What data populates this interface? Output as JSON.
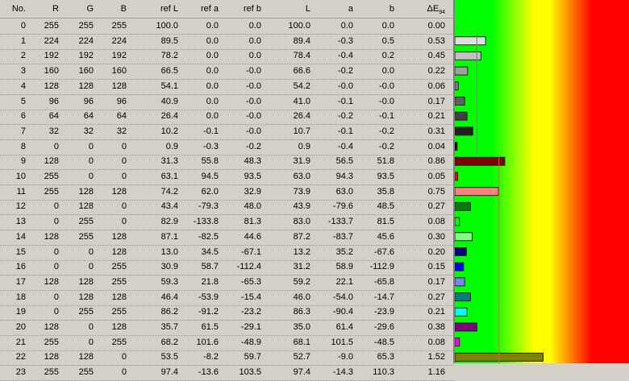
{
  "table": {
    "columns": [
      "No.",
      "R",
      "G",
      "B",
      "ref L",
      "ref a",
      "ref b",
      "L",
      "a",
      "b"
    ],
    "delta_label": "ΔE",
    "delta_sub": "94",
    "rows": [
      [
        "0",
        "255",
        "255",
        "255",
        "100.0",
        "0.0",
        "0.0",
        "100.0",
        "0.0",
        "0.0",
        "0.00"
      ],
      [
        "1",
        "224",
        "224",
        "224",
        "89.5",
        "0.0",
        "0.0",
        "89.4",
        "-0.3",
        "0.5",
        "0.53"
      ],
      [
        "2",
        "192",
        "192",
        "192",
        "78.2",
        "0.0",
        "0.0",
        "78.4",
        "-0.4",
        "0.2",
        "0.45"
      ],
      [
        "3",
        "160",
        "160",
        "160",
        "66.5",
        "0.0",
        "-0.0",
        "66.6",
        "-0.2",
        "0.0",
        "0.22"
      ],
      [
        "4",
        "128",
        "128",
        "128",
        "54.1",
        "0.0",
        "-0.0",
        "54.2",
        "-0.0",
        "-0.0",
        "0.06"
      ],
      [
        "5",
        "96",
        "96",
        "96",
        "40.9",
        "0.0",
        "-0.0",
        "41.0",
        "-0.1",
        "-0.0",
        "0.17"
      ],
      [
        "6",
        "64",
        "64",
        "64",
        "26.4",
        "0.0",
        "-0.0",
        "26.4",
        "-0.2",
        "-0.1",
        "0.21"
      ],
      [
        "7",
        "32",
        "32",
        "32",
        "10.2",
        "-0.1",
        "-0.0",
        "10.7",
        "-0.1",
        "-0.2",
        "0.31"
      ],
      [
        "8",
        "0",
        "0",
        "0",
        "0.9",
        "-0.3",
        "-0.2",
        "0.9",
        "-0.4",
        "-0.2",
        "0.04"
      ],
      [
        "9",
        "128",
        "0",
        "0",
        "31.3",
        "55.8",
        "48.3",
        "31.9",
        "56.5",
        "51.8",
        "0.86"
      ],
      [
        "10",
        "255",
        "0",
        "0",
        "63.1",
        "94.5",
        "93.5",
        "63.0",
        "94.3",
        "93.5",
        "0.05"
      ],
      [
        "11",
        "255",
        "128",
        "128",
        "74.2",
        "62.0",
        "32.9",
        "73.9",
        "63.0",
        "35.8",
        "0.75"
      ],
      [
        "12",
        "0",
        "128",
        "0",
        "43.4",
        "-79.3",
        "48.0",
        "43.9",
        "-79.6",
        "48.5",
        "0.27"
      ],
      [
        "13",
        "0",
        "255",
        "0",
        "82.9",
        "-133.8",
        "81.3",
        "83.0",
        "-133.7",
        "81.5",
        "0.08"
      ],
      [
        "14",
        "128",
        "255",
        "128",
        "87.1",
        "-82.5",
        "44.6",
        "87.2",
        "-83.7",
        "45.6",
        "0.30"
      ],
      [
        "15",
        "0",
        "0",
        "128",
        "13.0",
        "34.5",
        "-67.1",
        "13.2",
        "35.2",
        "-67.6",
        "0.20"
      ],
      [
        "16",
        "0",
        "0",
        "255",
        "30.9",
        "58.7",
        "-112.4",
        "31.2",
        "58.9",
        "-112.9",
        "0.15"
      ],
      [
        "17",
        "128",
        "128",
        "255",
        "59.3",
        "21.8",
        "-65.3",
        "59.2",
        "22.1",
        "-65.8",
        "0.17"
      ],
      [
        "18",
        "0",
        "128",
        "128",
        "46.4",
        "-53.9",
        "-15.4",
        "46.0",
        "-54.0",
        "-14.7",
        "0.27"
      ],
      [
        "19",
        "0",
        "255",
        "255",
        "86.2",
        "-91.2",
        "-23.2",
        "86.3",
        "-90.4",
        "-23.9",
        "0.21"
      ],
      [
        "20",
        "128",
        "0",
        "128",
        "35.7",
        "61.5",
        "-29.1",
        "35.0",
        "61.4",
        "-29.6",
        "0.38"
      ],
      [
        "21",
        "255",
        "0",
        "255",
        "68.2",
        "101.6",
        "-48.9",
        "68.1",
        "101.5",
        "-48.5",
        "0.08"
      ],
      [
        "22",
        "128",
        "128",
        "0",
        "53.5",
        "-8.2",
        "59.7",
        "52.7",
        "-9.0",
        "65.3",
        "1.52"
      ],
      [
        "23",
        "255",
        "255",
        "0",
        "97.4",
        "-13.6",
        "103.5",
        "97.4",
        "-14.3",
        "110.3",
        "1.16"
      ]
    ]
  },
  "colors": {
    "panel_bg": "#d4d0c8",
    "zone_green": "#00ff00",
    "zone_yellow": "#ffff00",
    "zone_red": "#ff0000",
    "bar_border": "#202020"
  },
  "chart_data": {
    "type": "bar",
    "orientation": "horizontal",
    "zones": [
      {
        "color": "#00ff00",
        "upto": 1.0
      },
      {
        "color": "#ffff00",
        "upto": 2.0
      },
      {
        "color": "#ff0000",
        "upto": 3.0
      }
    ],
    "xlim": [
      0,
      3.0
    ],
    "categories": [
      "0",
      "1",
      "2",
      "3",
      "4",
      "5",
      "6",
      "7",
      "8",
      "9",
      "10",
      "11",
      "12",
      "13",
      "14",
      "15",
      "16",
      "17",
      "18",
      "19",
      "20",
      "21",
      "22",
      "23"
    ],
    "values": [
      0.0,
      0.53,
      0.45,
      0.22,
      0.06,
      0.17,
      0.21,
      0.31,
      0.04,
      0.86,
      0.05,
      0.75,
      0.27,
      0.08,
      0.3,
      0.2,
      0.15,
      0.17,
      0.27,
      0.21,
      0.38,
      0.08,
      1.52,
      1.16
    ],
    "bar_colors": [
      "#ffffff",
      "#e0e0e0",
      "#c0c0c0",
      "#a0a0a0",
      "#808080",
      "#606060",
      "#404040",
      "#202020",
      "#000000",
      "#800000",
      "#ff0000",
      "#ff8080",
      "#008000",
      "#00ff00",
      "#80ff80",
      "#000080",
      "#0000ff",
      "#8080ff",
      "#008080",
      "#00ffff",
      "#800080",
      "#ff00ff",
      "#808000",
      "#ffff00"
    ],
    "reference_lines": [
      {
        "value": 0.38,
        "from_row": 1,
        "to_row": 8,
        "color": "#808080"
      },
      {
        "value": 0.76,
        "from_row": 9,
        "to_row": 23,
        "color": "#c07040"
      }
    ]
  }
}
